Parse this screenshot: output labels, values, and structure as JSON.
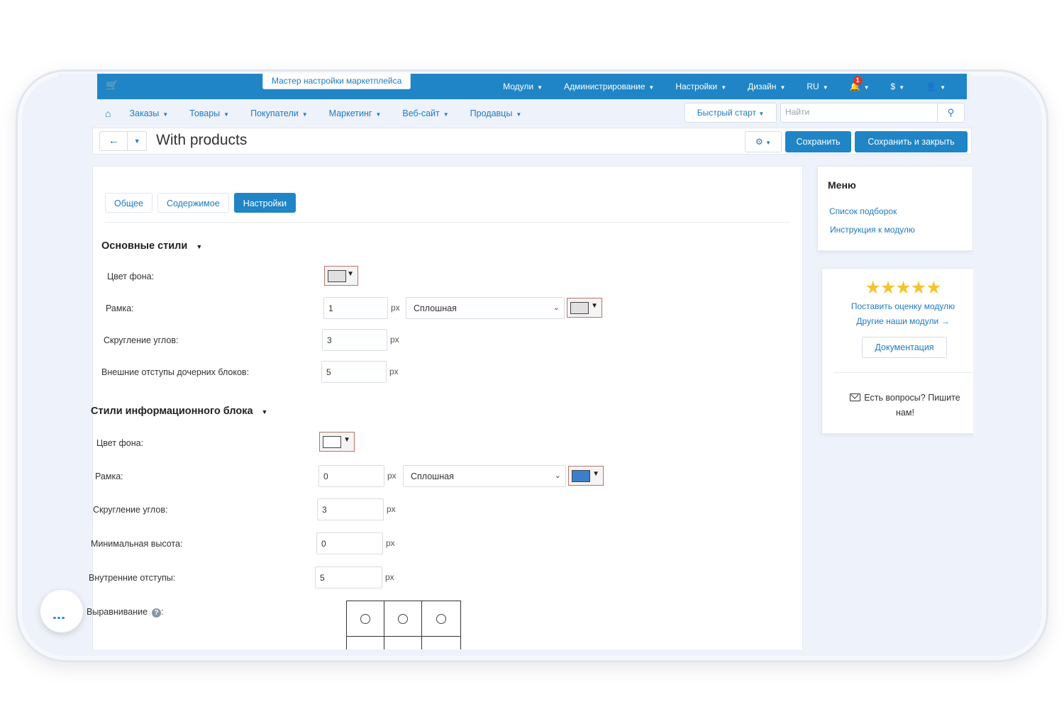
{
  "topbar": {
    "wizard_label": "Мастер настройки маркетплейса",
    "menu": [
      {
        "label": "Модули"
      },
      {
        "label": "Администрирование"
      },
      {
        "label": "Настройки"
      },
      {
        "label": "Дизайн"
      },
      {
        "label": "RU"
      }
    ],
    "notifications_count": "1",
    "currency_label": "$"
  },
  "nav": {
    "items": [
      {
        "label": "Заказы"
      },
      {
        "label": "Товары"
      },
      {
        "label": "Покупатели"
      },
      {
        "label": "Маркетинг"
      },
      {
        "label": "Веб-сайт"
      },
      {
        "label": "Продавцы"
      }
    ],
    "quick_start_label": "Быстрый старт",
    "search_placeholder": "Найти"
  },
  "titlebar": {
    "title": "With products",
    "save_label": "Сохранить",
    "save_close_label": "Сохранить и закрыть"
  },
  "tabs": [
    {
      "label": "Общее",
      "active": false
    },
    {
      "label": "Содержимое",
      "active": false
    },
    {
      "label": "Настройки",
      "active": true
    }
  ],
  "section_main": {
    "title": "Основные стили",
    "bg_label": "Цвет фона:",
    "bg_color": "#e0e0e0",
    "border_label": "Рамка:",
    "border_width": "1",
    "border_style": "Сплошная",
    "border_color": "#e0e0e0",
    "radius_label": "Скругление углов:",
    "radius_value": "3",
    "margin_label": "Внешние отступы дочерних блоков:",
    "margin_value": "5",
    "unit": "px"
  },
  "section_info": {
    "title": "Стили информационного блока",
    "bg_label": "Цвет фона:",
    "bg_color": "#ffffff",
    "border_label": "Рамка:",
    "border_width": "0",
    "border_style": "Сплошная",
    "border_color": "#3b7fcb",
    "radius_label": "Скругление углов:",
    "radius_value": "3",
    "min_height_label": "Минимальная высота:",
    "min_height_value": "0",
    "padding_label": "Внутренние отступы:",
    "padding_value": "5",
    "align_label": "Выравнивание",
    "unit": "px"
  },
  "menu_panel": {
    "title": "Меню",
    "links": [
      {
        "label": "Список подборок"
      },
      {
        "label": "Инструкция к модулю"
      }
    ]
  },
  "rate_panel": {
    "stars": "★★★★★",
    "rate_label": "Поставить оценку модулю",
    "other_label": "Другие наши модули →",
    "docs_label": "Документация",
    "contact_label": "Есть вопросы? Пишите нам!"
  },
  "colors": {
    "primary": "#1f85c6",
    "link": "#1f7bc0",
    "star": "#f4c430"
  }
}
